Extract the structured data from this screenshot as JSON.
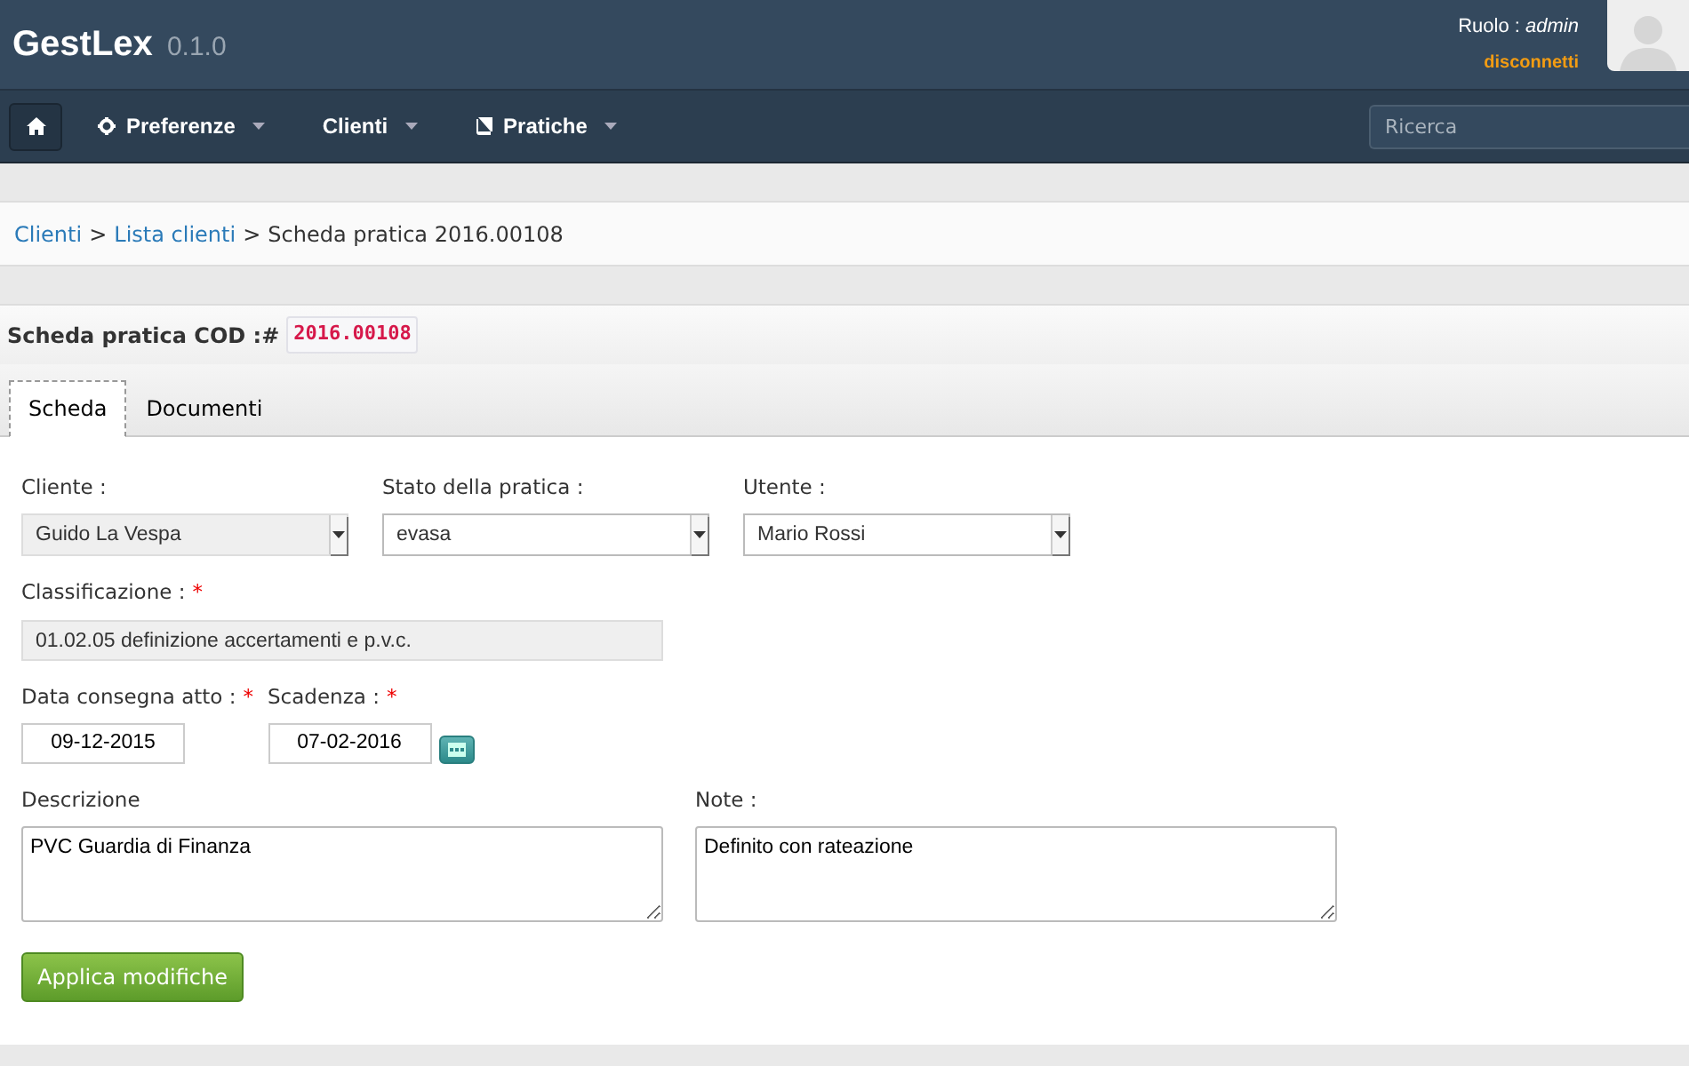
{
  "header": {
    "brand": "GestLex",
    "version": "0.1.0",
    "role_label": "Ruolo :",
    "role": "admin",
    "logout": "disconnetti"
  },
  "nav": {
    "items": [
      {
        "kind": "home"
      },
      {
        "kind": "settings",
        "label": "Preferenze"
      },
      {
        "kind": "plain",
        "label": "Clienti"
      },
      {
        "kind": "book",
        "label": "Pratiche"
      }
    ],
    "search": {
      "placeholder": "Ricerca"
    }
  },
  "breadcrumb": [
    {
      "kind": "link",
      "label": "Clienti"
    },
    {
      "kind": "separator",
      "label": ">"
    },
    {
      "kind": "link",
      "label": "Lista clienti"
    },
    {
      "kind": "separator",
      "label": ">"
    },
    {
      "kind": "current",
      "label": "Scheda pratica 2016.00108"
    }
  ],
  "title": {
    "label": "Scheda pratica COD :#",
    "code": "2016.00108"
  },
  "tabs": [
    {
      "label": "Scheda",
      "selected": true
    },
    {
      "label": "Documenti",
      "selected": false
    }
  ],
  "form": {
    "selects": [
      {
        "label": "Cliente :",
        "value": "Guido La Vespa",
        "disabled": true
      },
      {
        "label": "Stato della pratica :",
        "value": "evasa",
        "disabled": false
      },
      {
        "label": "Utente :",
        "value": "Mario Rossi",
        "disabled": false
      }
    ],
    "classification": {
      "label": "Classificazione :",
      "required_mark": "*",
      "value": "01.02.05 definizione accertamenti e p.v.c."
    },
    "dates": [
      {
        "kind": "date",
        "label": "Data consegna atto :",
        "required_mark": "*",
        "value": "09-12-2015"
      },
      {
        "kind": "date-picker",
        "label": "Scadenza :",
        "required_mark": "*",
        "value": "07-02-2016"
      }
    ],
    "textareas": [
      {
        "label": "Descrizione",
        "value": "PVC Guardia di Finanza"
      },
      {
        "label": "Note :",
        "value": "Definito con rateazione"
      }
    ],
    "submit": "Applica modifiche"
  }
}
